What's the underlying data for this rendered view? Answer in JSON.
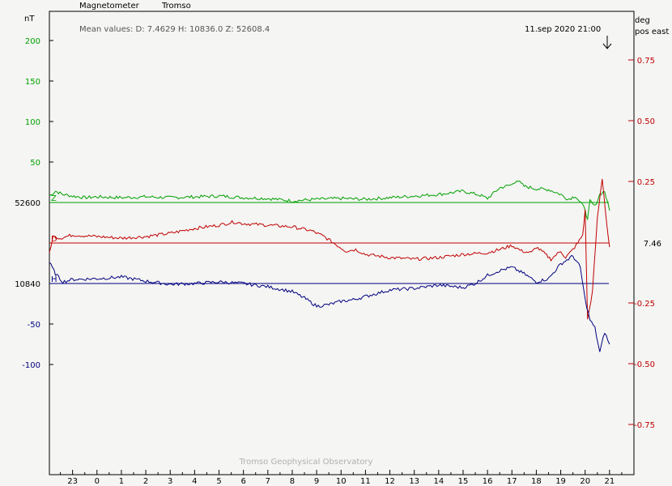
{
  "header": {
    "instrument": "Magnetometer",
    "station": "Tromso",
    "mean_values": "Mean values:  D: 7.4629    H: 10836.0    Z: 52608.4",
    "timestamp": "11.sep 2020 21:00",
    "left_unit": "nT",
    "right_unit_line1": "deg",
    "right_unit_line2": "pos east",
    "footer": "Tromso Geophysical Observatory"
  },
  "colors": {
    "background": "#f5f5f3",
    "frame": "#000000",
    "Z": "#00a000",
    "D": "#c00000",
    "H": "#000080"
  },
  "chart_data": {
    "type": "line",
    "x_unit": "hour (UT)",
    "xlim": [
      22.05,
      23.0
    ],
    "x_ticks": [
      {
        "label": "23",
        "x": 23
      },
      {
        "label": "0",
        "x": 24
      },
      {
        "label": "1",
        "x": 25
      },
      {
        "label": "2",
        "x": 26
      },
      {
        "label": "3",
        "x": 27
      },
      {
        "label": "4",
        "x": 28
      },
      {
        "label": "5",
        "x": 29
      },
      {
        "label": "6",
        "x": 30
      },
      {
        "label": "7",
        "x": 31
      },
      {
        "label": "8",
        "x": 32
      },
      {
        "label": "9",
        "x": 33
      },
      {
        "label": "10",
        "x": 34
      },
      {
        "label": "11",
        "x": 35
      },
      {
        "label": "12",
        "x": 36
      },
      {
        "label": "13",
        "x": 37
      },
      {
        "label": "14",
        "x": 38
      },
      {
        "label": "15",
        "x": 39
      },
      {
        "label": "16",
        "x": 40
      },
      {
        "label": "17",
        "x": 41
      },
      {
        "label": "18",
        "x": 42
      },
      {
        "label": "19",
        "x": 43
      },
      {
        "label": "20",
        "x": 44
      },
      {
        "label": "21",
        "x": 45
      }
    ],
    "x_range": [
      22.05,
      46.0
    ],
    "y_range_nT": [
      -170,
      232
    ],
    "left_ticks": [
      {
        "label": "200",
        "value": 200,
        "color": "#00a000"
      },
      {
        "label": "150",
        "value": 150,
        "color": "#00a000"
      },
      {
        "label": "100",
        "value": 100,
        "color": "#00a000"
      },
      {
        "label": "50",
        "value": 50,
        "color": "#00a000"
      },
      {
        "label": "52600",
        "value": 0,
        "color": "#000000"
      },
      {
        "label": "10840",
        "value": -100,
        "color": "#000000"
      },
      {
        "label": "-50",
        "value": -150,
        "color": "#000080"
      },
      {
        "label": "-100",
        "value": -200,
        "color": "#000080"
      }
    ],
    "right_ticks": [
      {
        "label": "0.75",
        "value": 0.75
      },
      {
        "label": "0.50",
        "value": 0.5
      },
      {
        "label": "0.25",
        "value": 0.25
      },
      {
        "label": "-0.25",
        "value": -0.25
      },
      {
        "label": "-0.50",
        "value": -0.5
      },
      {
        "label": "-0.75",
        "value": -0.75
      }
    ],
    "right_value_label": "7.46",
    "baselines": [
      {
        "name": "Z",
        "base_label": "52600",
        "color": "#00a000"
      },
      {
        "name": "D",
        "base_label": "7.46",
        "color": "#c00000"
      },
      {
        "name": "H",
        "base_label": "10840",
        "color": "#000080"
      }
    ],
    "series": [
      {
        "name": "Z",
        "color": "#00a000",
        "unit": "nT offset from 52600",
        "x": [
          22.05,
          22.3,
          22.6,
          23.0,
          23.5,
          24.0,
          25.0,
          26.0,
          27.0,
          28.0,
          29.0,
          30.0,
          31.0,
          32.0,
          33.0,
          34.0,
          35.0,
          36.0,
          37.0,
          38.0,
          39.0,
          39.7,
          40.0,
          40.5,
          41.0,
          41.2,
          41.5,
          42.0,
          42.5,
          43.0,
          43.3,
          43.6,
          43.8,
          44.0,
          44.1,
          44.2,
          44.4,
          44.6,
          44.8,
          45.0
        ],
        "values": [
          8,
          14,
          10,
          8,
          6,
          7,
          6,
          7,
          6,
          7,
          8,
          6,
          5,
          2,
          4,
          5,
          4,
          6,
          8,
          10,
          14,
          9,
          5,
          18,
          22,
          28,
          20,
          17,
          16,
          10,
          4,
          8,
          0,
          -8,
          -22,
          2,
          -5,
          10,
          14,
          -10
        ]
      },
      {
        "name": "D",
        "color": "#c00000",
        "unit": "nT offset from 7.46 deg baseline",
        "x": [
          22.05,
          22.2,
          22.5,
          23.0,
          24.0,
          25.0,
          26.0,
          27.0,
          28.0,
          29.0,
          29.6,
          30.0,
          31.0,
          32.0,
          32.8,
          33.3,
          33.8,
          34.2,
          34.6,
          35.0,
          36.0,
          37.0,
          38.0,
          39.0,
          40.0,
          40.5,
          41.0,
          41.4,
          41.8,
          42.0,
          42.3,
          42.6,
          43.0,
          43.2,
          43.5,
          43.7,
          43.9,
          44.0,
          44.1,
          44.3,
          44.5,
          44.7,
          44.9,
          45.0
        ],
        "values": [
          -12,
          8,
          6,
          10,
          8,
          6,
          8,
          12,
          18,
          22,
          26,
          24,
          22,
          20,
          15,
          8,
          -2,
          -10,
          -8,
          -14,
          -18,
          -20,
          -18,
          -14,
          -12,
          -8,
          -3,
          -10,
          -12,
          -5,
          -12,
          -20,
          -10,
          -18,
          -8,
          0,
          10,
          40,
          -95,
          -60,
          30,
          80,
          20,
          -5
        ]
      },
      {
        "name": "H",
        "color": "#000080",
        "unit": "nT offset from 10840",
        "x": [
          22.05,
          22.3,
          22.6,
          23.0,
          24.0,
          25.0,
          26.0,
          27.0,
          28.0,
          29.0,
          30.0,
          31.0,
          32.0,
          32.5,
          33.0,
          33.5,
          34.0,
          34.5,
          35.0,
          36.0,
          37.0,
          38.0,
          39.0,
          39.5,
          40.0,
          40.5,
          41.0,
          41.5,
          42.0,
          42.5,
          43.0,
          43.5,
          43.8,
          44.0,
          44.2,
          44.4,
          44.6,
          44.8,
          45.0
        ],
        "values": [
          26,
          12,
          2,
          5,
          6,
          8,
          3,
          -1,
          0,
          2,
          0,
          -4,
          -10,
          -18,
          -28,
          -26,
          -22,
          -20,
          -16,
          -8,
          -6,
          -2,
          -5,
          0,
          10,
          16,
          20,
          12,
          2,
          6,
          24,
          34,
          20,
          -20,
          -45,
          -55,
          -85,
          -60,
          -75
        ]
      }
    ]
  }
}
